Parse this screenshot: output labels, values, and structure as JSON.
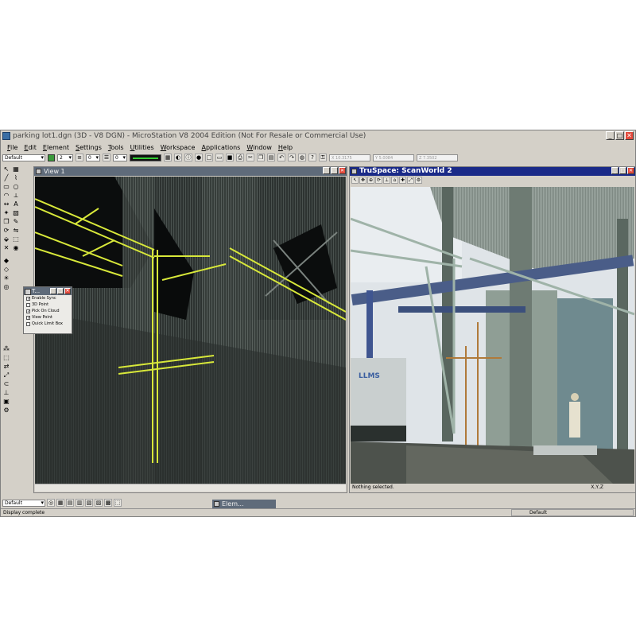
{
  "app": {
    "title": "parking lot1.dgn (3D - V8 DGN) - MicroStation V8 2004 Edition (Not For Resale or Commercial Use)",
    "window_buttons": [
      "_",
      "□",
      "✕"
    ]
  },
  "menu": [
    "File",
    "Edit",
    "Element",
    "Settings",
    "Tools",
    "Utilities",
    "Workspace",
    "Applications",
    "Window",
    "Help"
  ],
  "toolbar": {
    "level": "Default",
    "weight_value": "2",
    "style_value": "0",
    "line_weight_value": "0",
    "coords": [
      "X 10.3175",
      "Y 5.0084",
      "Z 7.3502"
    ],
    "accent_color": "#3a9a3a"
  },
  "view1": {
    "title": "View 1",
    "colors": {
      "background": "#141716",
      "highlight": "#d8e83a"
    }
  },
  "view2": {
    "title": "TruSpace: ScanWorld 2",
    "status": "Nothing selected.",
    "axis_label": "X,Y,Z",
    "title_color": "#1a2a88"
  },
  "dialog": {
    "title": "T...",
    "options": [
      {
        "label": "Enable Sync",
        "checked": true
      },
      {
        "label": "3D Point",
        "checked": false
      },
      {
        "label": "Pick On Cloud",
        "checked": true
      },
      {
        "label": "View Point",
        "checked": true
      },
      {
        "label": "Quick Limit Box",
        "checked": false
      }
    ]
  },
  "bottom": {
    "level": "Default",
    "element_window_title": "Elem...",
    "status": "Display complete",
    "level_display": "Default"
  }
}
